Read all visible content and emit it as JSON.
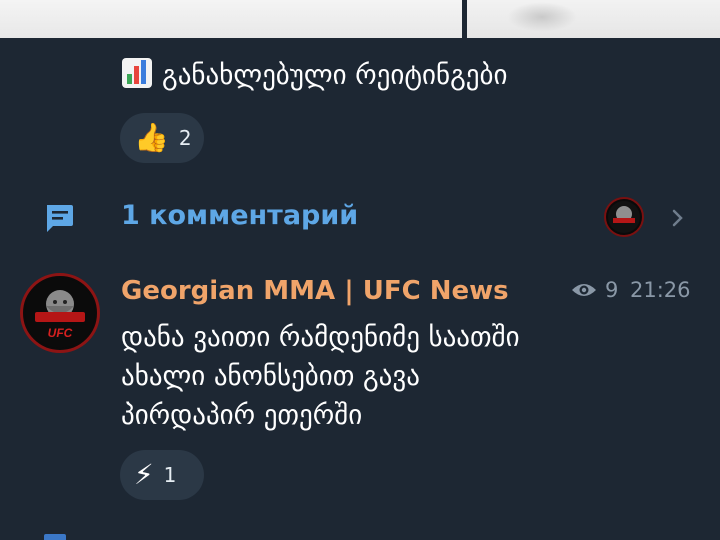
{
  "post": {
    "title_emoji": "chart-increasing-icon",
    "title": "განახლებული რეიტინგები",
    "reaction": {
      "emoji": "👍",
      "count": "2"
    }
  },
  "comments": {
    "label": "1 комментарий",
    "accent_color": "#5ea7e6"
  },
  "message": {
    "channel": "Georgian MMA | UFC News",
    "channel_color": "#f0a46a",
    "views": "9",
    "time": "21:26",
    "lines": [
      "დანა ვაითი რამდენიმე საათში",
      "ახალი ანონსებით გავა",
      "პირდაპირ ეთერში"
    ],
    "reaction": {
      "emoji": "⚡",
      "count": "1"
    }
  },
  "avatar_text": "UFC"
}
